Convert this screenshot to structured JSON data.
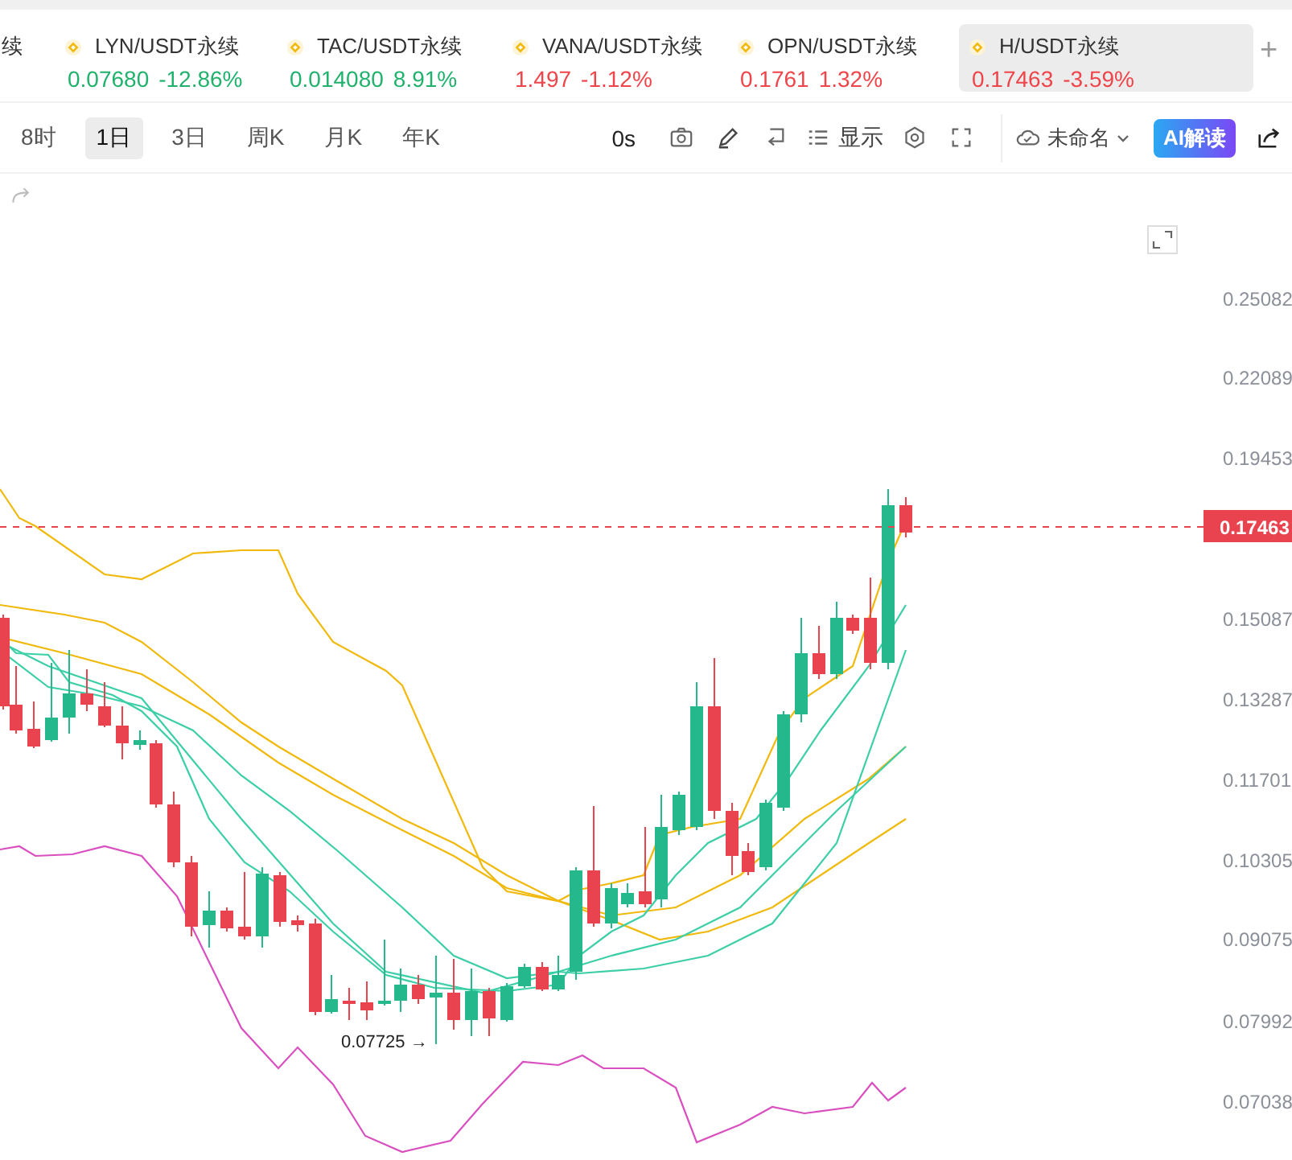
{
  "tickers": [
    {
      "symbol": "续",
      "selected": false
    },
    {
      "symbol": "LYN/USDT永续",
      "price": "0.07680",
      "change": "-12.86%",
      "color": "#20b26c",
      "selected": false
    },
    {
      "symbol": "TAC/USDT永续",
      "price": "0.014080",
      "change": "8.91%",
      "color": "#20b26c",
      "selected": false
    },
    {
      "symbol": "VANA/USDT永续",
      "price": "1.497",
      "change": "-1.12%",
      "color": "#ef454a",
      "selected": false
    },
    {
      "symbol": "OPN/USDT永续",
      "price": "0.1761",
      "change": "1.32%",
      "color": "#ef454a",
      "selected": false
    },
    {
      "symbol": "H/USDT永续",
      "price": "0.17463",
      "change": "-3.59%",
      "color": "#ef454a",
      "selected": true
    }
  ],
  "add_tab": "+",
  "intervals": [
    {
      "label": "8时",
      "selected": false
    },
    {
      "label": "1日",
      "selected": true
    },
    {
      "label": "3日",
      "selected": false
    },
    {
      "label": "周K",
      "selected": false
    },
    {
      "label": "月K",
      "selected": false
    },
    {
      "label": "年K",
      "selected": false
    }
  ],
  "toolbar": {
    "countdown": "0s",
    "display": "显示",
    "layout_name": "未命名",
    "ai_button": "AI解读"
  },
  "price_axis": [
    "0.25082",
    "0.22089",
    "0.19453",
    "0.15087",
    "0.13287",
    "0.11701",
    "0.10305",
    "0.09075",
    "0.07992",
    "0.07038"
  ],
  "current_price": "0.17463",
  "low_marker": "0.07725 →"
}
